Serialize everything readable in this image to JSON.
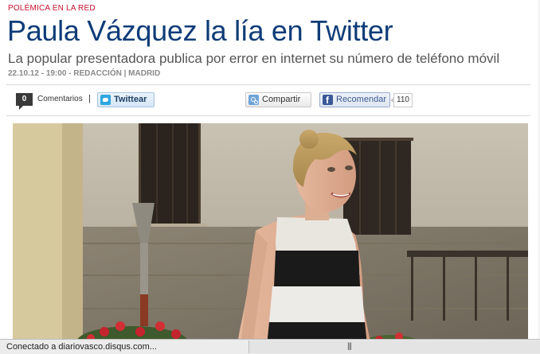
{
  "article": {
    "kicker": "POLÉMICA EN LA RED",
    "headline": "Paula Vázquez la lía en Twitter",
    "subtitle": "La popular presentadora publica por error en internet su número de teléfono móvil",
    "byline": "22.10.12 - 19:00 - REDACCIÓN | MADRID"
  },
  "social": {
    "comment_count": "0",
    "comments_label": "Comentarios",
    "separator": "|",
    "tweet_label": "Twittear",
    "share_label": "Compartir",
    "like_label": "Recomendar",
    "like_count": "110"
  },
  "status": {
    "text": "Conectado a diariovasco.disqus.com...",
    "grip": "|||"
  },
  "colors": {
    "headline": "#0f3c78",
    "kicker": "#c8102e",
    "facebook": "#3b5998",
    "twitter": "#2fa7e0"
  },
  "icons": [
    "twitter-bird-icon",
    "share-icon",
    "facebook-icon"
  ]
}
